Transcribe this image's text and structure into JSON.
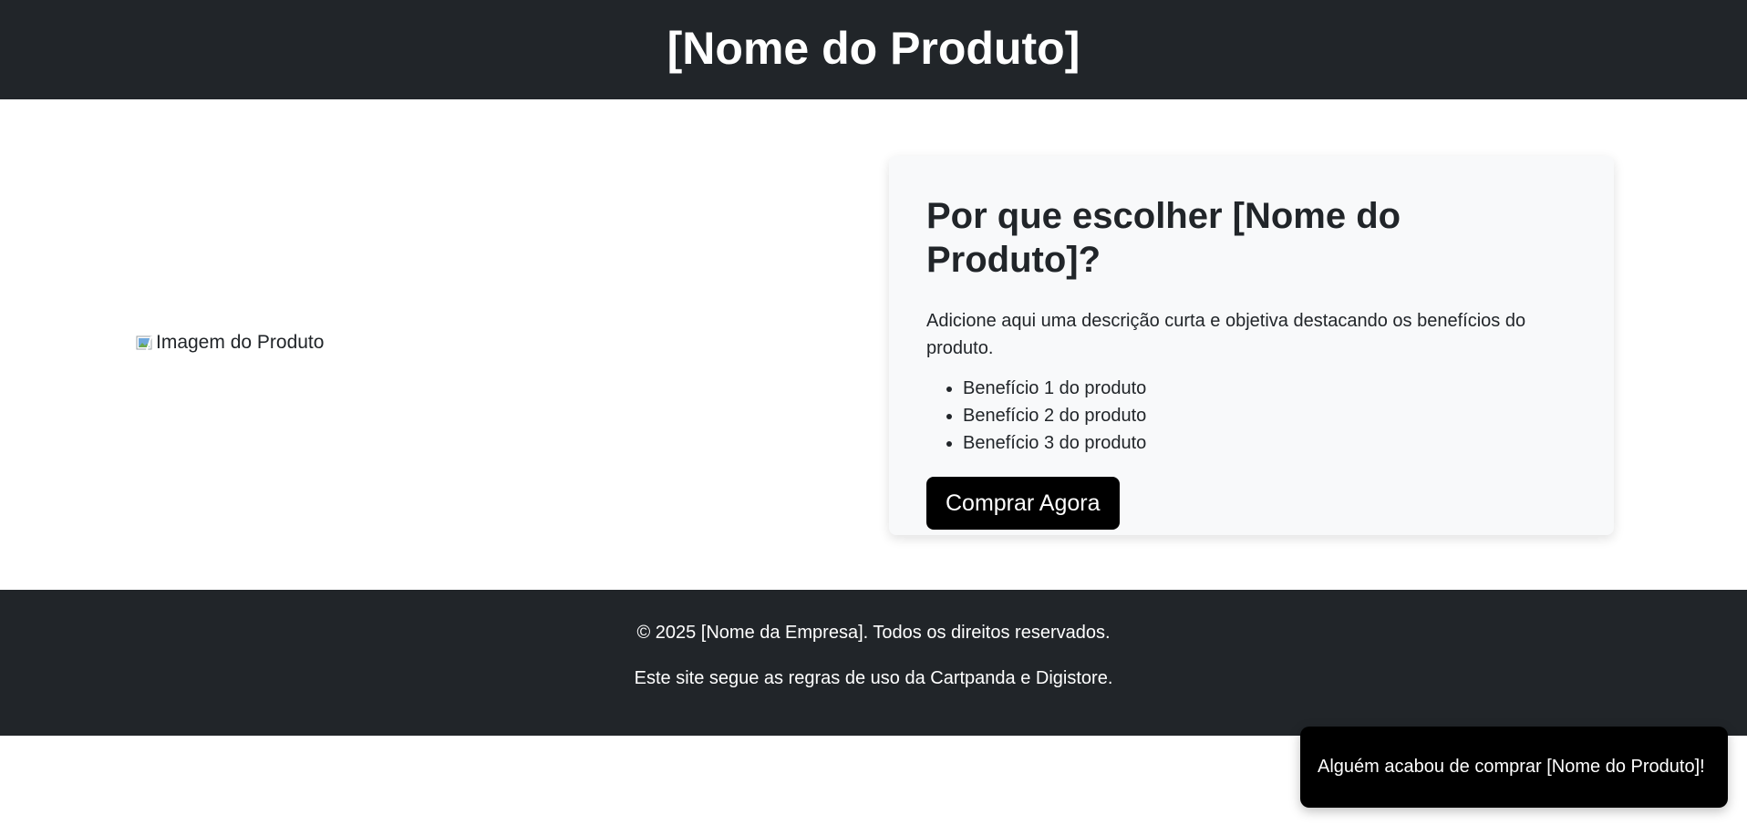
{
  "header": {
    "title": "[Nome do Produto]"
  },
  "product": {
    "image_alt": "Imagem do Produto"
  },
  "card": {
    "heading": "Por que escolher [Nome do Produto]?",
    "description": "Adicione aqui uma descrição curta e objetiva destacando os benefícios do produto.",
    "benefits": [
      "Benefício 1 do produto",
      "Benefício 2 do produto",
      "Benefício 3 do produto"
    ],
    "buy_button_label": "Comprar Agora"
  },
  "footer": {
    "copyright": "© 2025 [Nome da Empresa]. Todos os direitos reservados.",
    "notice": "Este site segue as regras de uso da Cartpanda e Digistore."
  },
  "toast": {
    "message": "Alguém acabou de comprar [Nome do Produto]!"
  },
  "colors": {
    "header_bg": "#212529",
    "footer_bg": "#212529",
    "card_bg": "#f8f9fa",
    "button_bg": "#000000",
    "toast_bg": "#000000"
  }
}
